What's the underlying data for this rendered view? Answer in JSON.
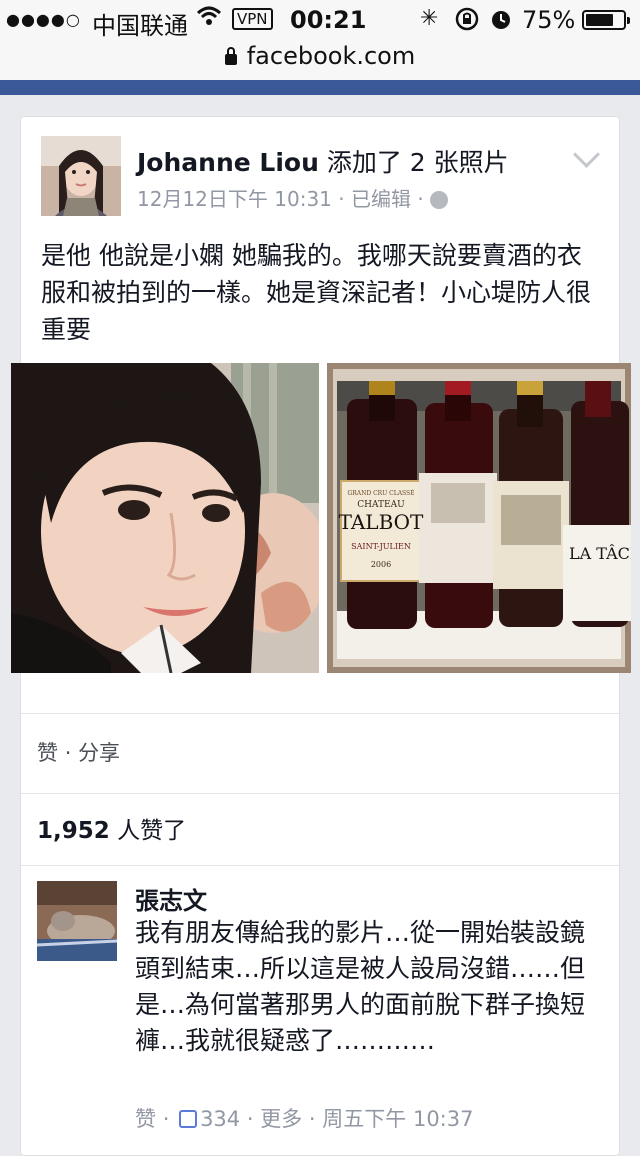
{
  "status_bar": {
    "signal_dots": "●●●●○",
    "carrier": "中国联通",
    "vpn": "VPN",
    "time": "00:21",
    "battery_percent": "75%",
    "battery_level": 0.75
  },
  "browser": {
    "url": "facebook.com"
  },
  "post": {
    "author": "Johanne Liou",
    "action": "添加了 2 张照片",
    "timestamp": "12月12日下午 10:31",
    "separator": "·",
    "edited": "已编辑",
    "text": "是他 他說是小嫻 她騙我的。我哪天說要賣酒的衣服和被拍到的一樣。她是資深記者！小心堤防人很重要"
  },
  "photo_labels": {
    "bottle1_small": "GRAND CRU CLASSÉ",
    "bottle1_brand_top": "CHATEAU",
    "bottle1_brand": "TALBOT",
    "bottle1_region": "SAINT-JULIEN",
    "bottle1_year": "2006",
    "bottle4_label": "LA TÂCH"
  },
  "actions": {
    "like": "赞",
    "dot": "·",
    "share": "分享"
  },
  "likes": {
    "count": "1,952",
    "suffix": " 人赞了"
  },
  "comment": {
    "author": "張志文",
    "text": "我有朋友傳給我的影片…從一開始裝設鏡頭到結束…所以這是被人設局沒錯……但是…為何當著那男人的面前脫下群子換短褲…我就很疑惑了…………",
    "like": "赞",
    "dot": "·",
    "like_count": "334",
    "more": "更多",
    "time": "周五下午 10:37"
  },
  "colors": {
    "facebook_blue": "#3b5998",
    "meta_gray": "#9197a3",
    "text_dark": "#141823"
  },
  "icons": [
    "wifi-icon",
    "lock-icon",
    "globe-icon",
    "chevron-down-icon",
    "thumbs-up-icon",
    "rotation-lock-icon",
    "alarm-icon"
  ]
}
